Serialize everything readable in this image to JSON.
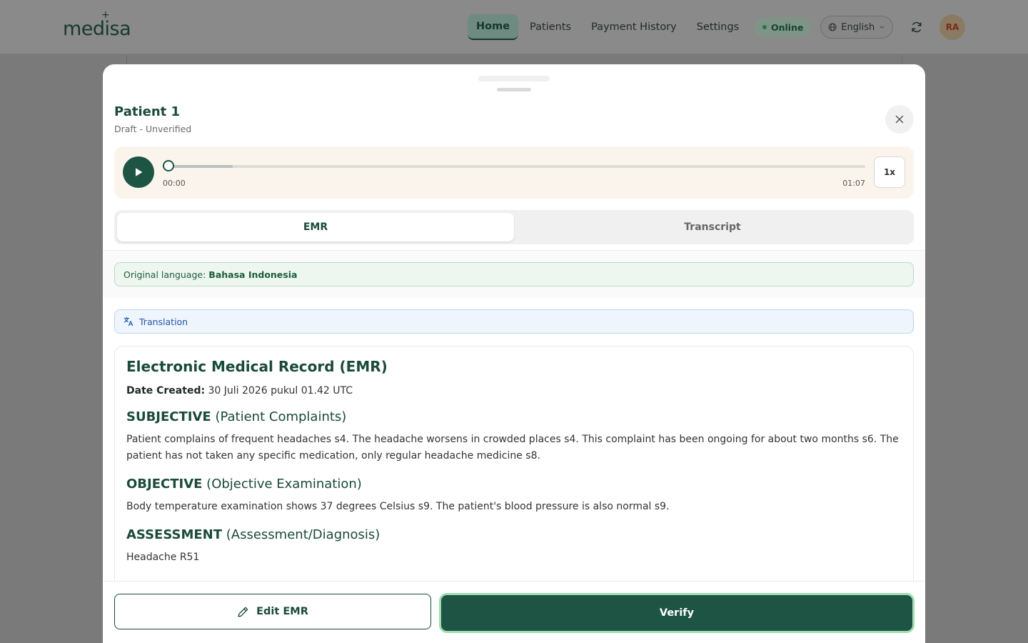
{
  "header": {
    "logo_text": "medisa",
    "nav": [
      {
        "label": "Home",
        "active": true
      },
      {
        "label": "Patients",
        "active": false
      },
      {
        "label": "Payment History",
        "active": false
      },
      {
        "label": "Settings",
        "active": false
      }
    ],
    "status": "Online",
    "language": "English",
    "avatar_initials": "RA"
  },
  "modal": {
    "patient_name": "Patient 1",
    "patient_status": "Draft - Unverified",
    "player": {
      "current_time": "00:00",
      "total_time": "01:07",
      "progress_fraction": 0.0,
      "buffered_fraction": 0.1,
      "speed": "1x"
    },
    "tabs": [
      {
        "label": "EMR",
        "active": true
      },
      {
        "label": "Transcript",
        "active": false
      }
    ],
    "original_language_label": "Original language:",
    "original_language_value": "Bahasa Indonesia",
    "translation_label": "Translation",
    "emr": {
      "title": "Electronic Medical Record (EMR)",
      "date_label": "Date Created:",
      "date_value": "30 Juli 2026 pukul 01.42 UTC",
      "sections": [
        {
          "heading_bold": "SUBJECTIVE",
          "heading_rest": "(Patient Complaints)",
          "body": "Patient complains of frequent headaches s4. The headache worsens in crowded places s4. This complaint has been ongoing for about two months s6. The patient has not taken any specific medication, only regular headache medicine s8."
        },
        {
          "heading_bold": "OBJECTIVE",
          "heading_rest": "(Objective Examination)",
          "body": "Body temperature examination shows 37 degrees Celsius s9. The patient's blood pressure is also normal s9."
        },
        {
          "heading_bold": "ASSESSMENT",
          "heading_rest": "(Assessment/Diagnosis)",
          "body": "Headache R51"
        }
      ]
    },
    "edit_button": "Edit EMR",
    "verify_button": "Verify"
  },
  "colors": {
    "primary": "#1d5443",
    "overlay": "#7a7a7a",
    "player_bg": "#fbf4ec"
  }
}
